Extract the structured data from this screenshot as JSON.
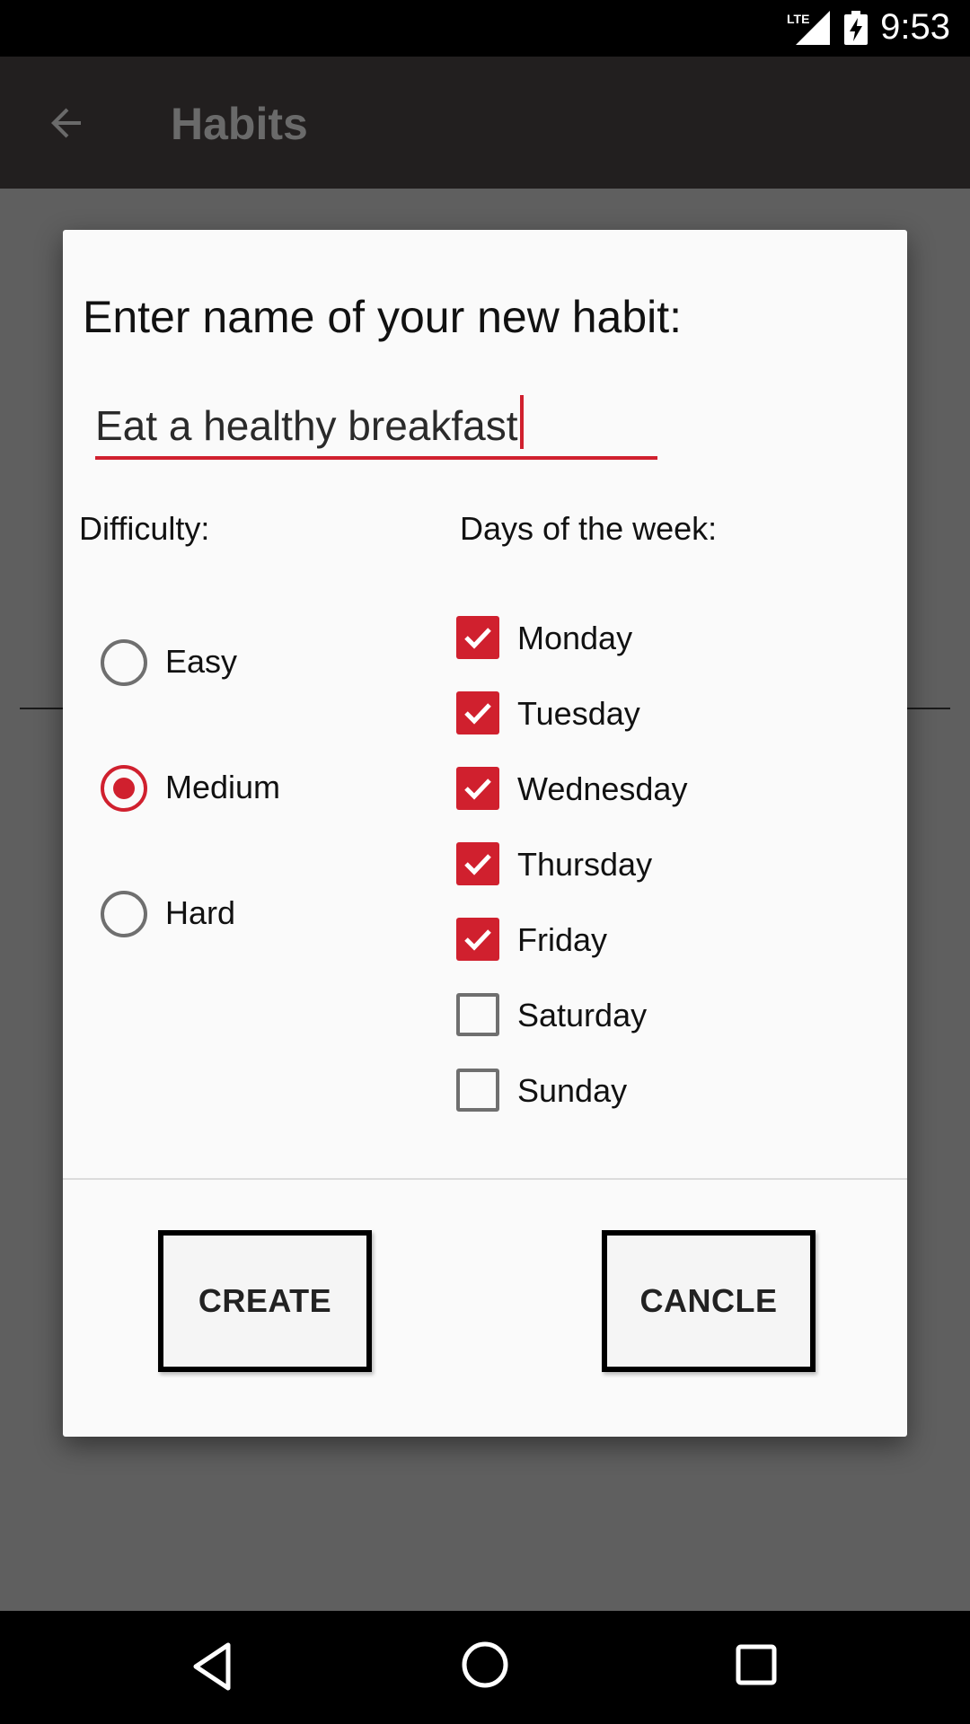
{
  "status_bar": {
    "time": "9:53",
    "network_label": "LTE",
    "icons": [
      "lte-signal-icon",
      "battery-charging-icon"
    ]
  },
  "app_bar": {
    "title": "Habits",
    "back_icon": "arrow-back-icon"
  },
  "dialog": {
    "prompt": "Enter name of your new habit:",
    "name_value": "Eat a healthy breakfast",
    "difficulty_label": "Difficulty:",
    "difficulty_options": [
      {
        "label": "Easy",
        "selected": false
      },
      {
        "label": "Medium",
        "selected": true
      },
      {
        "label": "Hard",
        "selected": false
      }
    ],
    "days_label": "Days of the week:",
    "days": [
      {
        "label": "Monday",
        "checked": true
      },
      {
        "label": "Tuesday",
        "checked": true
      },
      {
        "label": "Wednesday",
        "checked": true
      },
      {
        "label": "Thursday",
        "checked": true
      },
      {
        "label": "Friday",
        "checked": true
      },
      {
        "label": "Saturday",
        "checked": false
      },
      {
        "label": "Sunday",
        "checked": false
      }
    ],
    "create_label": "CREATE",
    "cancel_label": "CANCLE"
  },
  "colors": {
    "accent": "#d0202e",
    "app_bar": "#221f1f",
    "scrim": "#5f5f5f",
    "dialog_bg": "#fafafa"
  },
  "nav_bar": {
    "icons": [
      "back-triangle-icon",
      "home-circle-icon",
      "recents-square-icon"
    ]
  }
}
